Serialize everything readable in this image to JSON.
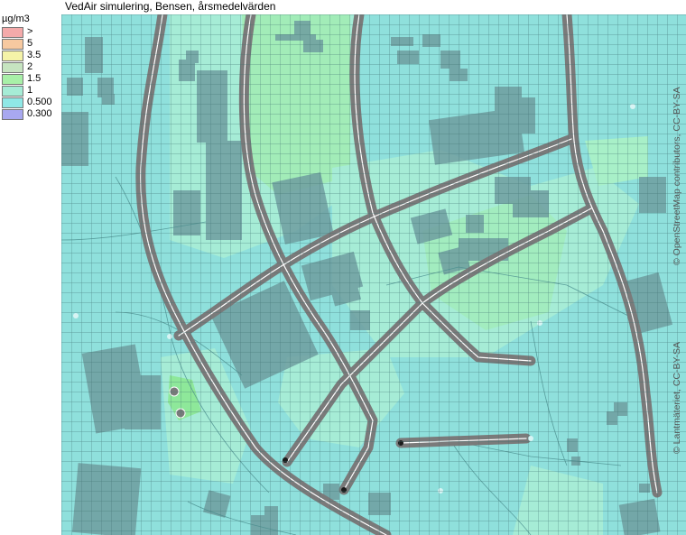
{
  "title": "VedAir simulering, Bensen, årsmedelvärden",
  "legend": {
    "unit": "µg/m3",
    "items": [
      {
        "label": ">",
        "color": "#f4aaaa"
      },
      {
        "label": "5",
        "color": "#f7c9a0"
      },
      {
        "label": "3.5",
        "color": "#f5f3a8"
      },
      {
        "label": "2",
        "color": "#c6e4c0"
      },
      {
        "label": "1.5",
        "color": "#a8f0a8"
      },
      {
        "label": "1",
        "color": "#a6ecd6"
      },
      {
        "label": "0.500",
        "color": "#8fe8e6"
      },
      {
        "label": "0.300",
        "color": "#a8a8f0"
      }
    ]
  },
  "attribution": {
    "osm": "© OpenStreetMap contributors, CC-BY-SA",
    "lm": "© Lantmäteriet, CC-BY-SA"
  },
  "colors": {
    "background": "#8fe0dc",
    "low_zone": "#a6ecd6",
    "mid_zone": "#a8f0a8",
    "grid": "#3d6e6e",
    "building": "#6f9ea0",
    "road": "#7a7a7a",
    "road_edge": "#ffffff"
  }
}
